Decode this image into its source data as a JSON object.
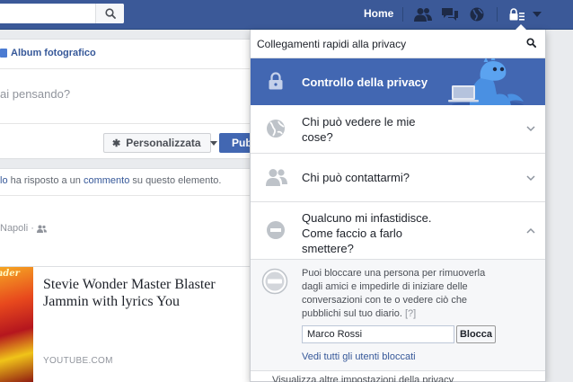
{
  "topbar": {
    "home_label": "Home"
  },
  "compose": {
    "album_tab": "Album fotografico",
    "placeholder": "ai pensando?",
    "audience_label": "Personalizzata",
    "publish_label": "Pubblica"
  },
  "post": {
    "activity_name": "lo",
    "activity_text_1": "ha risposto a un",
    "activity_link": "commento",
    "activity_text_2": "su questo elemento.",
    "location": "Napoli",
    "preview": {
      "thumb_text": "nder",
      "title": "Stevie Wonder Master Blaster Jammin with lyrics You",
      "domain": "YOUTUBE.COM"
    }
  },
  "privacy_panel": {
    "title": "Collegamenti rapidi alla privacy",
    "privacy_check": "Controllo della privacy",
    "faq": [
      {
        "line1": "Chi può vedere le mie",
        "line2": "cose?"
      },
      {
        "line1": "Chi può contattarmi?"
      },
      {
        "line1": "Qualcuno mi infastidisce.",
        "line2": "Come faccio a farlo",
        "line3": "smettere?"
      }
    ],
    "block": {
      "description": "Puoi bloccare una persona per rimuoverla dagli amici e impedirle di iniziare delle conversazioni con te o vedere ciò che pubblichi sul tuo diario.",
      "hint": "[?]",
      "input_value": "Marco Rossi",
      "button_label": "Blocca",
      "see_all_link": "Vedi tutti gli utenti bloccati"
    },
    "tail_text": "Visualizza altre impostazioni della privacy"
  },
  "colors": {
    "brand_blue": "#3b5998",
    "accent_blue": "#4267b2",
    "link_blue": "#365899"
  }
}
